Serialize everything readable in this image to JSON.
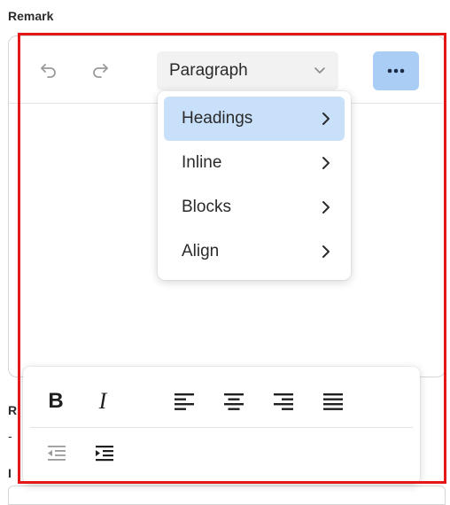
{
  "field": {
    "label": "Remark"
  },
  "below": {
    "line1": "R",
    "line2": "-",
    "line3": "I"
  },
  "toolbar": {
    "undo_icon": "undo-icon",
    "redo_icon": "redo-icon",
    "block_format_value": "Paragraph",
    "more_icon": "more-horizontal-icon"
  },
  "menu": {
    "items": [
      {
        "label": "Headings",
        "active": true
      },
      {
        "label": "Inline",
        "active": false
      },
      {
        "label": "Blocks",
        "active": false
      },
      {
        "label": "Align",
        "active": false
      }
    ]
  },
  "format_toolbar": {
    "bold_label": "B",
    "italic_label": "I",
    "icons": [
      "align-left-icon",
      "align-center-icon",
      "align-right-icon",
      "align-justify-icon",
      "outdent-icon",
      "indent-icon"
    ]
  },
  "colors": {
    "highlight_frame": "#e41818",
    "active_menu_item": "#c9e0fa",
    "more_button": "#a9cdf5"
  }
}
